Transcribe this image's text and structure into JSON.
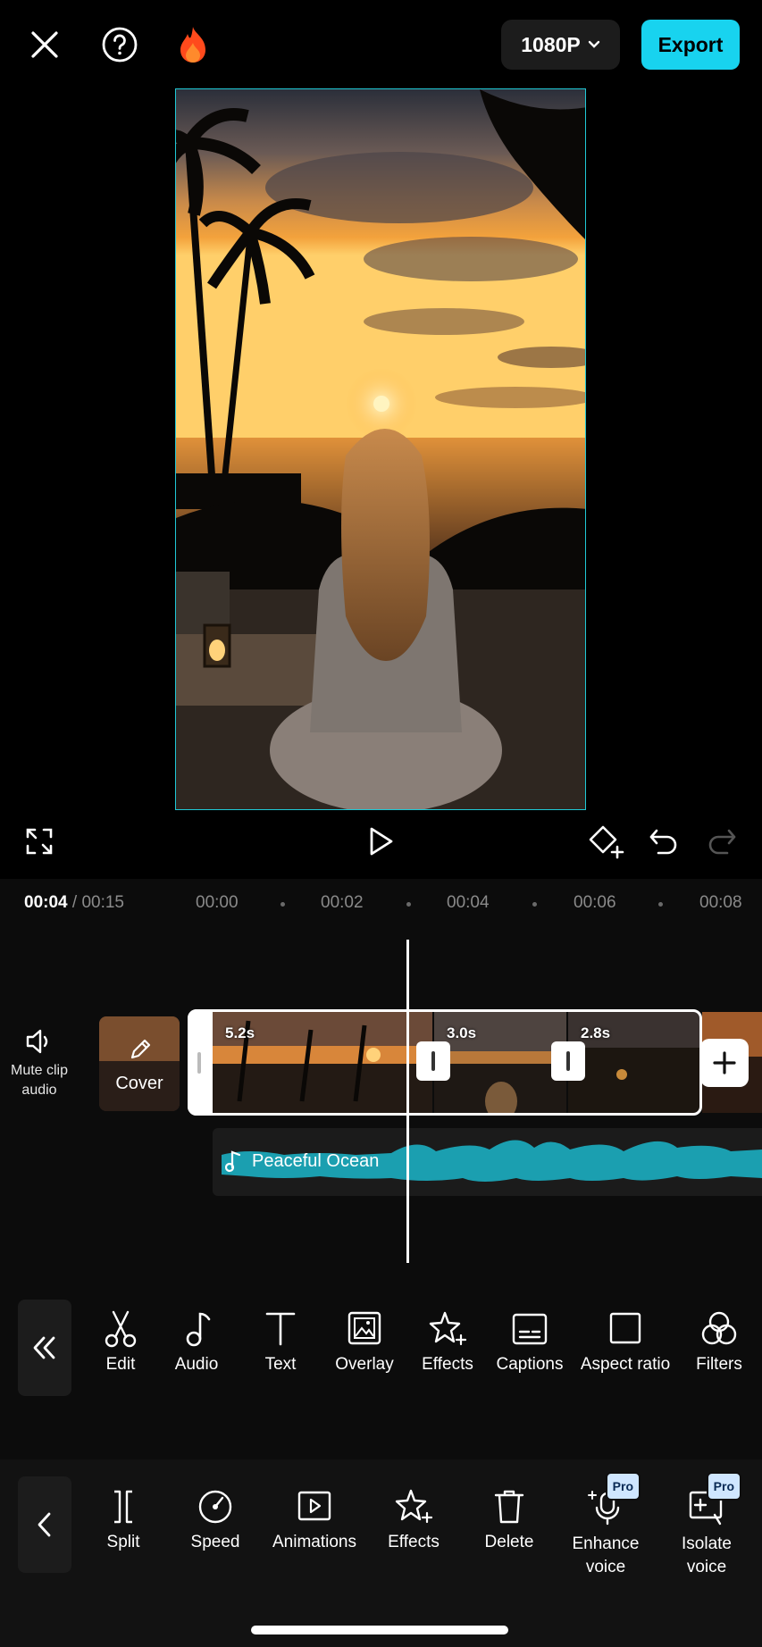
{
  "topbar": {
    "close_icon": "close-icon",
    "help_icon": "help-icon",
    "fire_icon": "fire-icon",
    "resolution": "1080P",
    "export_label": "Export",
    "accent": "#18d3ef"
  },
  "preview": {
    "description_icon": "image"
  },
  "timeline": {
    "current": "00:04",
    "total": "/ 00:15",
    "ticks": [
      "00:00",
      "00:02",
      "00:04",
      "00:06",
      "00:08"
    ],
    "mute_label": "Mute clip audio",
    "cover_label": "Cover",
    "clips": [
      "5.2s",
      "3.0s",
      "2.8s"
    ],
    "audio_label": "Peaceful Ocean",
    "audio_color": "#1b9fb0"
  },
  "toolbar": {
    "items": [
      {
        "label": "Edit",
        "icon": "scissors-icon"
      },
      {
        "label": "Audio",
        "icon": "music-note-icon"
      },
      {
        "label": "Text",
        "icon": "text-icon"
      },
      {
        "label": "Overlay",
        "icon": "overlay-icon"
      },
      {
        "label": "Effects",
        "icon": "star-sparkle-icon"
      },
      {
        "label": "Captions",
        "icon": "captions-icon"
      },
      {
        "label": "Aspect ratio",
        "icon": "aspect-ratio-icon"
      },
      {
        "label": "Filters",
        "icon": "filters-icon"
      }
    ]
  },
  "sheet": {
    "items": [
      {
        "label": "Split",
        "icon": "split-icon"
      },
      {
        "label": "Speed",
        "icon": "speed-icon"
      },
      {
        "label": "Animations",
        "icon": "animations-icon"
      },
      {
        "label": "Effects",
        "icon": "effects-icon"
      },
      {
        "label": "Delete",
        "icon": "trash-icon"
      },
      {
        "label": "Enhance voice",
        "icon": "enhance-voice-icon",
        "badge": "Pro"
      },
      {
        "label": "Isolate voice",
        "icon": "isolate-voice-icon",
        "badge": "Pro"
      }
    ]
  }
}
